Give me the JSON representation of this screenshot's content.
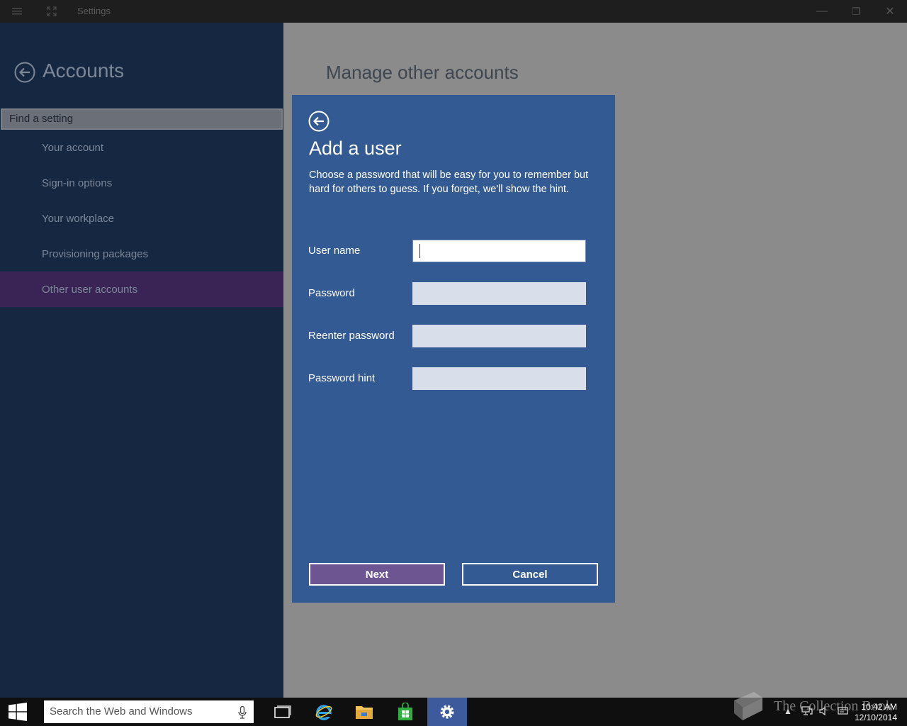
{
  "titlebar": {
    "title": "Settings",
    "minimize_label": "—",
    "restore_label": "❐",
    "close_label": "✕"
  },
  "sidebar": {
    "title": "Accounts",
    "search_placeholder": "Find a setting",
    "items": [
      {
        "label": "Your account"
      },
      {
        "label": "Sign-in options"
      },
      {
        "label": "Your workplace"
      },
      {
        "label": "Provisioning packages"
      },
      {
        "label": "Other user accounts"
      }
    ]
  },
  "main": {
    "title": "Manage other accounts"
  },
  "dialog": {
    "title": "Add a user",
    "description": "Choose a password that will be easy for you to remember but hard for others to guess. If you forget, we'll show the hint.",
    "fields": [
      {
        "label": "User name",
        "value": ""
      },
      {
        "label": "Password",
        "value": ""
      },
      {
        "label": "Reenter password",
        "value": ""
      },
      {
        "label": "Password hint",
        "value": ""
      }
    ],
    "next_label": "Next",
    "cancel_label": "Cancel"
  },
  "taskbar": {
    "search_placeholder": "Search the Web and Windows",
    "apps": [
      "task-view",
      "internet-explorer",
      "file-explorer",
      "store",
      "settings"
    ],
    "active_app": "settings",
    "time": "10:42 AM",
    "date": "12/10/2014"
  },
  "watermark": {
    "text": "The Collection Book"
  },
  "colors": {
    "sidebar_bg": "#162741",
    "active_item_bg": "#3a2456",
    "dialog_bg": "#335a92",
    "next_button_bg": "#6c5590",
    "overlay_bg": "#8b8b8b"
  }
}
